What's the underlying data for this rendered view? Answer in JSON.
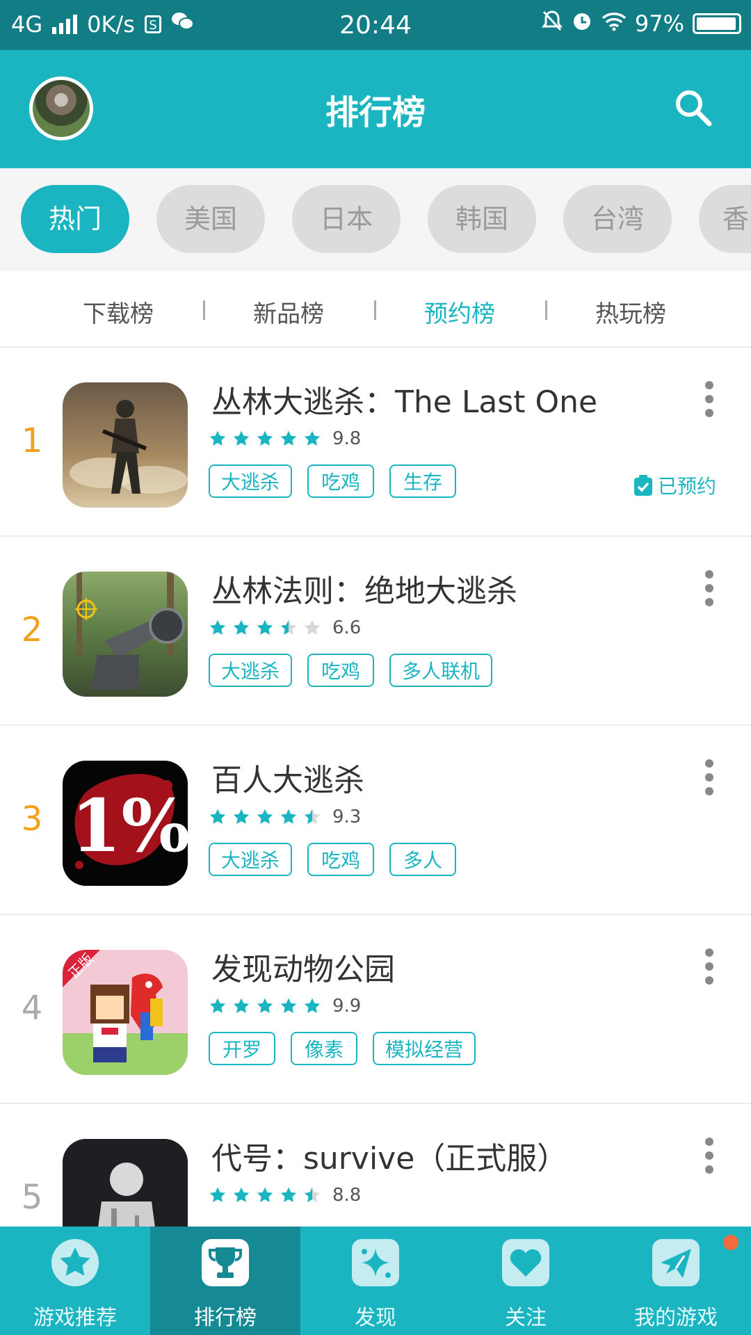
{
  "status_bar": {
    "network": "4G",
    "speed": "0K/s",
    "sim_icon": "S",
    "time": "20:44",
    "battery": "97%",
    "battery_level": 0.97
  },
  "header": {
    "title": "排行榜",
    "avatar_icon": "user-avatar",
    "search_icon": "search-icon"
  },
  "regions": [
    "热门",
    "美国",
    "日本",
    "韩国",
    "台湾",
    "香"
  ],
  "active_region": "热门",
  "tabs": [
    "下载榜",
    "新品榜",
    "预约榜",
    "热玩榜"
  ],
  "active_tab": "预约榜",
  "games": [
    {
      "rank": "1",
      "name": "丛林大逃杀：The Last One",
      "rating": 5,
      "score": "9.8",
      "tags": [
        "大逃杀",
        "吃鸡",
        "生存"
      ],
      "reserved": "已预约"
    },
    {
      "rank": "2",
      "name": "丛林法则：绝地大逃杀",
      "rating": 3.5,
      "score": "6.6",
      "tags": [
        "大逃杀",
        "吃鸡",
        "多人联机"
      ]
    },
    {
      "rank": "3",
      "name": "百人大逃杀",
      "rating": 4.5,
      "score": "9.3",
      "tags": [
        "大逃杀",
        "吃鸡",
        "多人"
      ],
      "icon_text": "1%"
    },
    {
      "rank": "4",
      "name": "发现动物公园",
      "rating": 5,
      "score": "9.9",
      "tags": [
        "开罗",
        "像素",
        "模拟经营"
      ],
      "icon_badge": "正版"
    },
    {
      "rank": "5",
      "name": "代号：survive（正式服）",
      "rating": 4.5,
      "score": "8.8",
      "tags": []
    }
  ],
  "bottom_nav": [
    {
      "label": "游戏推荐",
      "icon": "star-icon"
    },
    {
      "label": "排行榜",
      "icon": "trophy-icon"
    },
    {
      "label": "发现",
      "icon": "sparkle-icon"
    },
    {
      "label": "关注",
      "icon": "heart-icon"
    },
    {
      "label": "我的游戏",
      "icon": "paper-plane-icon"
    }
  ],
  "active_nav": "排行榜",
  "colors": {
    "primary": "#1bb5c2",
    "status_bar": "#137d86",
    "rank_top": "#f3a01b",
    "rank_normal": "#a9a9a9",
    "badge": "#f46b3e"
  }
}
